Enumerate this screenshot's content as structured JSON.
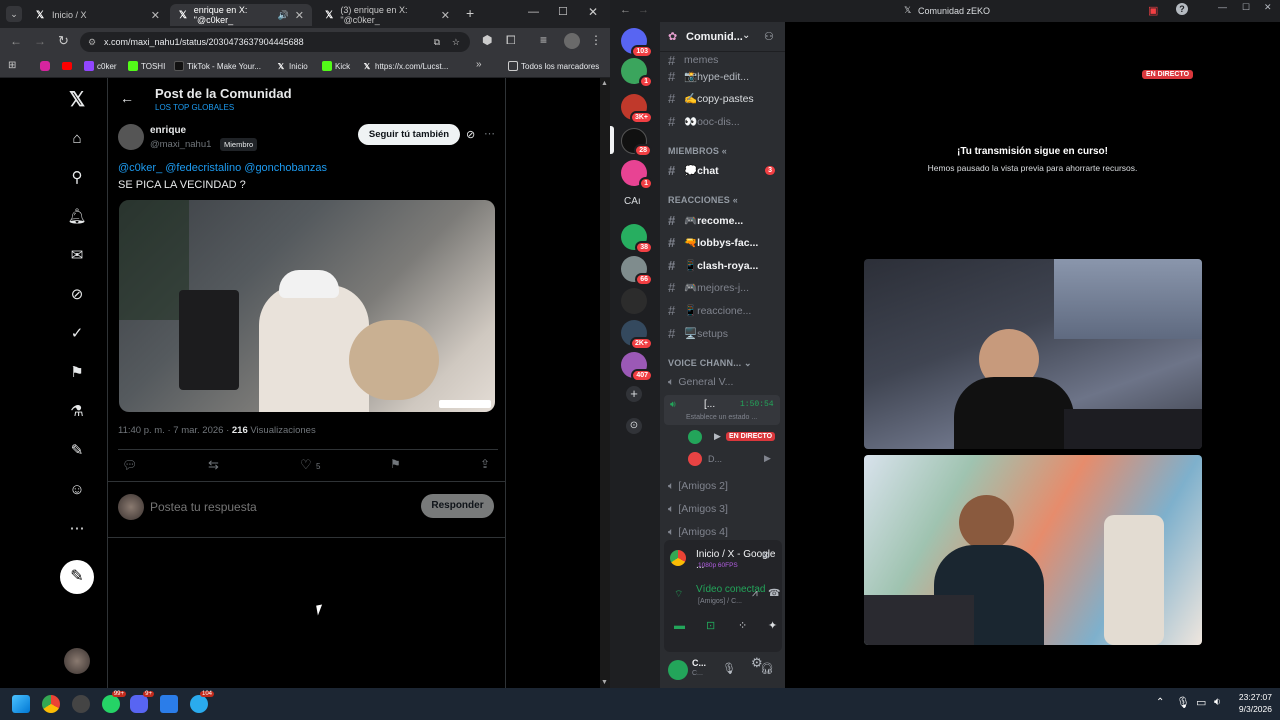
{
  "chrome": {
    "tabs": [
      {
        "title": "Inicio / X"
      },
      {
        "title": "enrique en X: \"@c0ker_"
      },
      {
        "title": "(3) enrique en X: \"@c0ker_"
      }
    ],
    "url": "x.com/maxi_nahu1/status/2030473637904445688",
    "bookmarks": [
      "c0ker",
      "TOSHI",
      "TikTok - Make Your...",
      "Inicio",
      "Kick",
      "https://x.com/Lucst...",
      "Todos los marcadores"
    ]
  },
  "post": {
    "header_title": "Post de la Comunidad",
    "header_subtitle": "LOS TOP GLOBALES",
    "author_name": "enrique",
    "author_handle": "@maxi_nahu1",
    "member_badge": "Miembro",
    "follow_button": "Seguir tú también",
    "mentions": "@c0ker_ @fedecristalino @gonchobanzas",
    "text": "SE PICA LA VECINDAD ?",
    "time": "11:40 p. m. · 7 mar. 2026 ·",
    "views_count": "216",
    "views_label": "Visualizaciones",
    "likes": "5",
    "reply_placeholder": "Postea tu respuesta",
    "reply_button": "Responder"
  },
  "discord": {
    "window_title": "Comunidad zEKO",
    "server_name": "Comunid...",
    "guild_badges": [
      "103",
      "1",
      "3K+",
      "28",
      "1",
      "38",
      "66",
      "2K+",
      "407"
    ],
    "guild_text": "CAı",
    "channels": {
      "memes": "memes",
      "hype": "📸hype-edit...",
      "copy": "✍️copy-pastes",
      "ooc": "👀ooc-dis...",
      "cat_members": "MIEMBROS",
      "chat": "💭chat",
      "chat_badge": "3",
      "cat_reactions": "REACCIONES",
      "recome": "🎮recome...",
      "lobbys": "🔫lobbys-fac...",
      "clash": "📱clash-roya...",
      "mejores": "🎮mejores-j...",
      "reaccione": "📱reaccione...",
      "setups": "🖥️setups",
      "cat_voice": "VOICE CHANN...",
      "general": "General V...",
      "active_voice": "[...",
      "voice_timer": "1:50:54",
      "status_placeholder": "Establece un estado ...",
      "live_badge": "EN DIRECTO",
      "user_d": "D...",
      "amigos2": "[Amigos 2]",
      "amigos3": "[Amigos 3]",
      "amigos4": "[Amigos 4]"
    },
    "stream_panel": {
      "title": "Inicio / X - Google ...",
      "quality": "1080p 60FPS",
      "video_status": "Vídeo conectad",
      "video_channel": "[Amigos] / C..."
    },
    "user_panel": {
      "name": "C...",
      "sub": "C..."
    },
    "stage": {
      "live_badge": "EN DIRECTO",
      "msg_title": "¡Tu transmisión sigue en curso!",
      "msg_sub": "Hemos pausado la vista previa para ahorrarte recursos."
    }
  },
  "taskbar": {
    "time": "23:27:07",
    "date": "9/3/2026",
    "badges": [
      "99+",
      "9+",
      "104"
    ]
  }
}
